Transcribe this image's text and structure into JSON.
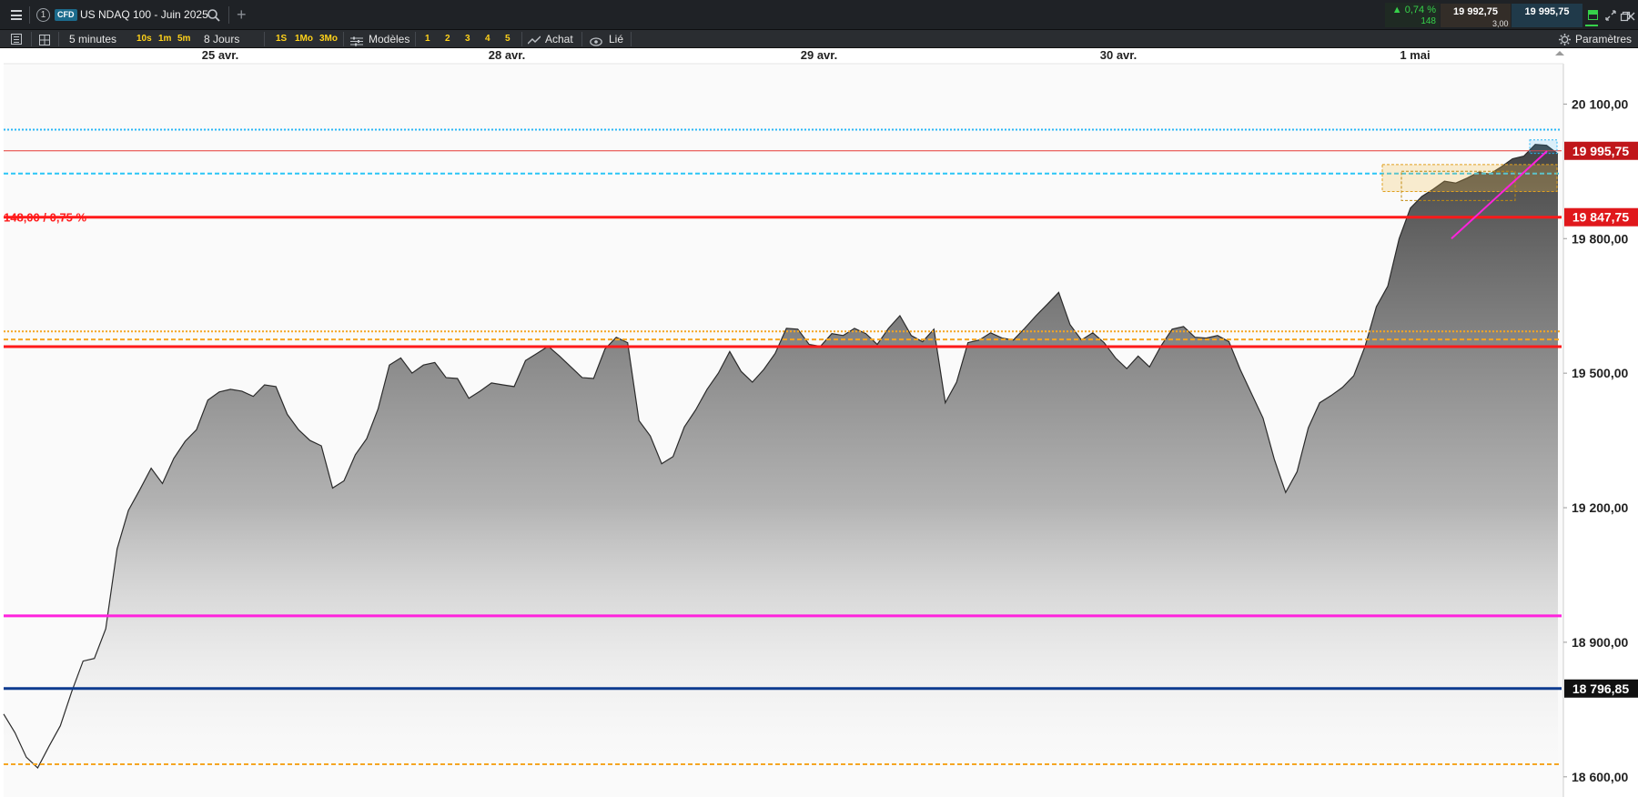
{
  "topbar": {
    "menu_icon": "hamburger-icon",
    "slot_number": "1",
    "instrument_type": "CFD",
    "instrument_name": "US NDAQ 100 - Juin 2025",
    "search_icon": "search-icon",
    "add_icon": "plus-icon",
    "change_percent": "▲ 0,74 %",
    "change_points": "148",
    "bid": "19 992,75",
    "spread": "3,00",
    "ask": "19 995,75",
    "window_icons": [
      "layout-icon",
      "minimize-icon",
      "restore-icon",
      "close-icon"
    ]
  },
  "toolbar": {
    "timeframe": "5 minutes",
    "quick_intervals": [
      "10s",
      "1m",
      "5m"
    ],
    "period": "8 Jours",
    "quick_periods": [
      "1S",
      "1Mo",
      "3Mo"
    ],
    "templates_label": "Modèles",
    "template_slots": [
      "1",
      "2",
      "3",
      "4",
      "5"
    ],
    "buy_label": "Achat",
    "linked_label": "Lié",
    "settings_label": "Paramètres"
  },
  "chart_data": {
    "type": "area",
    "x_labels": [
      "25 avr.",
      "28 avr.",
      "29 avr.",
      "30 avr.",
      "1 mai"
    ],
    "y_ticks": [
      {
        "label": "20 100,00",
        "value": 20100
      },
      {
        "label": "19 800,00",
        "value": 19800
      },
      {
        "label": "19 500,00",
        "value": 19500
      },
      {
        "label": "19 200,00",
        "value": 19200
      },
      {
        "label": "18 900,00",
        "value": 18900
      },
      {
        "label": "18 600,00",
        "value": 18600
      }
    ],
    "ylim": [
      18555,
      20190
    ],
    "price_tags": [
      {
        "label": "19 995,75",
        "value": 19995.75,
        "color": "#c0161a"
      },
      {
        "label": "19 847,75",
        "value": 19847.75,
        "color": "#e0181c"
      },
      {
        "label": "18 796,85",
        "value": 18796.85,
        "color": "#111111"
      }
    ],
    "annotation": "148,00 / 0,75 %",
    "lines": [
      {
        "value": 20043,
        "color": "#29b6f6",
        "style": "dotted",
        "width": 2
      },
      {
        "value": 19995.75,
        "color": "#e53935",
        "style": "solid",
        "width": 1
      },
      {
        "value": 19945,
        "color": "#29c5f6",
        "style": "dashed",
        "width": 2
      },
      {
        "value": 19847.75,
        "color": "#ff1a1a",
        "style": "solid",
        "width": 3
      },
      {
        "value": 19593,
        "color": "#f5a623",
        "style": "dotted",
        "width": 2
      },
      {
        "value": 19575,
        "color": "#f5a623",
        "style": "dashed",
        "width": 2
      },
      {
        "value": 19559,
        "color": "#ff1a1a",
        "style": "solid",
        "width": 3
      },
      {
        "value": 18959,
        "color": "#ff22dd",
        "style": "solid",
        "width": 3
      },
      {
        "value": 18796.85,
        "color": "#0d3b8f",
        "style": "solid",
        "width": 3
      },
      {
        "value": 18628,
        "color": "#f5a623",
        "style": "dashed",
        "width": 2
      }
    ],
    "series": [
      {
        "values": [
          18740,
          18690,
          18650,
          18620,
          18660,
          18720,
          18790,
          18850,
          18870,
          18930,
          19100,
          19200,
          19240,
          19280,
          19260,
          19310,
          19340,
          19380,
          19440,
          19450,
          19470,
          19460,
          19440,
          19480,
          19470,
          19400,
          19380,
          19350,
          19330,
          19250,
          19260,
          19310,
          19360,
          19420,
          19510,
          19540,
          19500,
          19510,
          19530,
          19490,
          19480,
          19450,
          19460,
          19470,
          19480,
          19470,
          19520,
          19550,
          19560,
          19530,
          19520,
          19490,
          19480,
          19560,
          19580,
          19560,
          19400,
          19360,
          19290,
          19320,
          19380,
          19410,
          19470,
          19500,
          19540,
          19510,
          19480,
          19500,
          19550,
          19600,
          19590,
          19570,
          19560,
          19580,
          19590,
          19600,
          19580,
          19570,
          19600,
          19620,
          19590,
          19570,
          19590,
          19440,
          19480,
          19560,
          19580,
          19590,
          19570,
          19580,
          19600,
          19620,
          19660,
          19680,
          19600,
          19580,
          19590,
          19560,
          19540,
          19510,
          19530,
          19520,
          19560,
          19590,
          19610,
          19580,
          19570,
          19590,
          19570,
          19500,
          19460,
          19400,
          19300,
          19240,
          19280,
          19370,
          19440,
          19450,
          19460,
          19500,
          19560,
          19640,
          19700,
          19800,
          19860,
          19900,
          19910,
          19920,
          19930,
          19935,
          19940,
          19950,
          19960,
          19970,
          19990,
          20010,
          20000,
          19995
        ]
      }
    ]
  }
}
